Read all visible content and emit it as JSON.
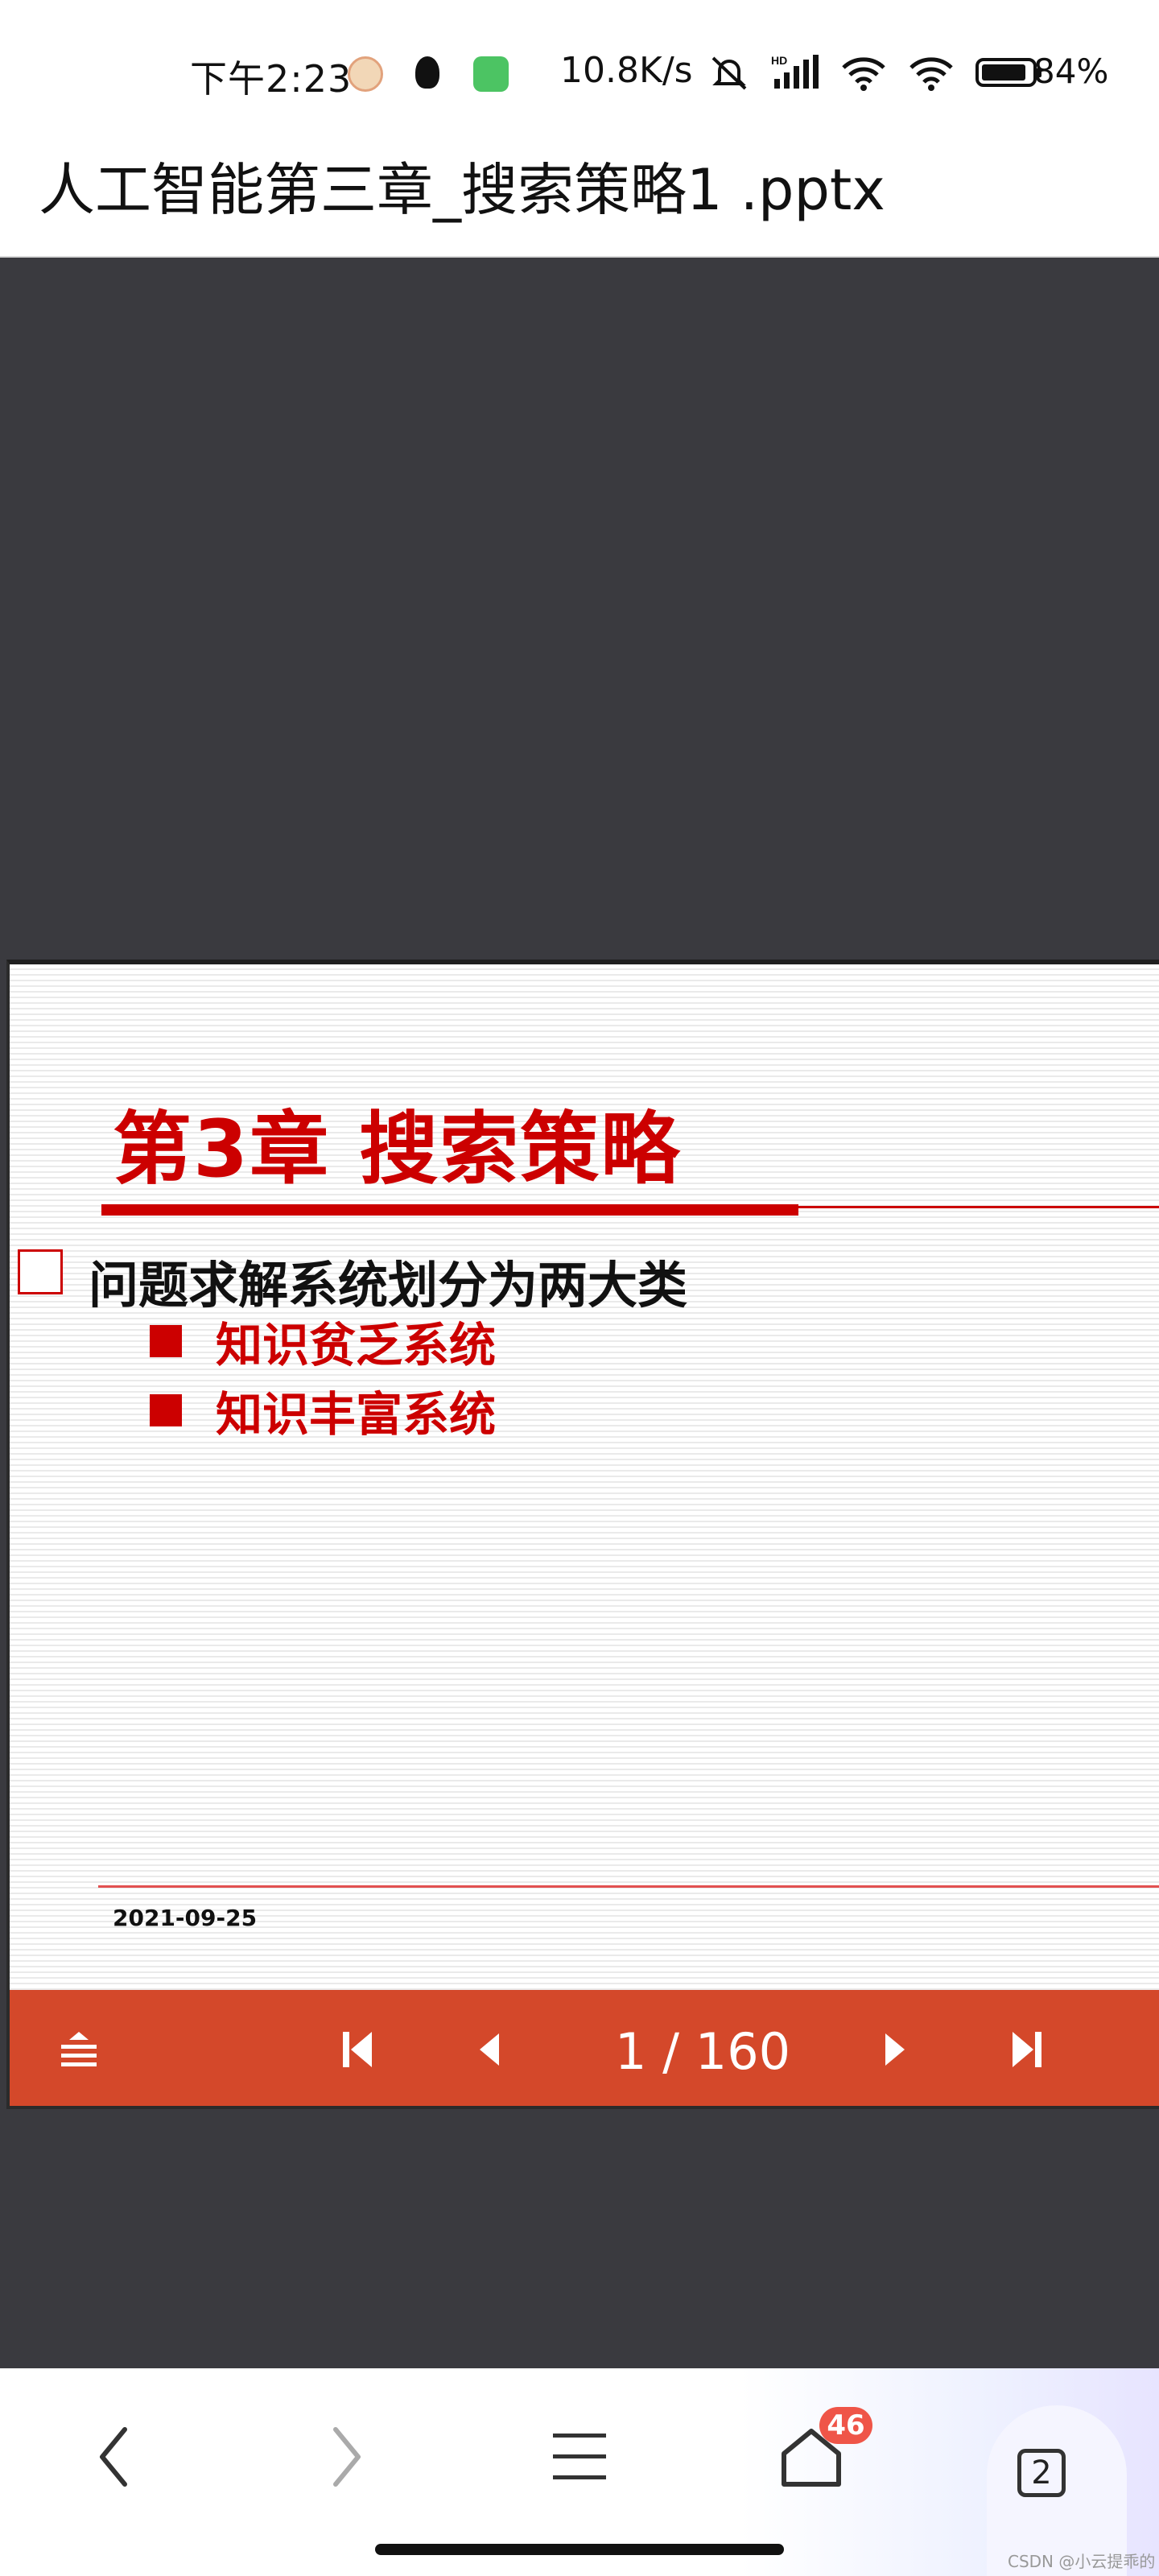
{
  "status_bar": {
    "time": "下午2:23",
    "network_speed": "10.8K/s",
    "battery": "84%"
  },
  "document": {
    "title": "人工智能第三章_搜索策略1 .pptx"
  },
  "slide": {
    "title": "第3章  搜索策略",
    "main_bullet": "问题求解系统划分为两大类",
    "sub_bullets": [
      "知识贫乏系统",
      "知识丰富系统"
    ],
    "date": "2021-09-25",
    "accent_color": "#cc0000"
  },
  "controls": {
    "page_counter": "1 / 160",
    "bar_color": "#d4482a"
  },
  "bottom_nav": {
    "badge_count": "46",
    "tab_count": "2"
  },
  "watermark": "CSDN @小云提乖的"
}
